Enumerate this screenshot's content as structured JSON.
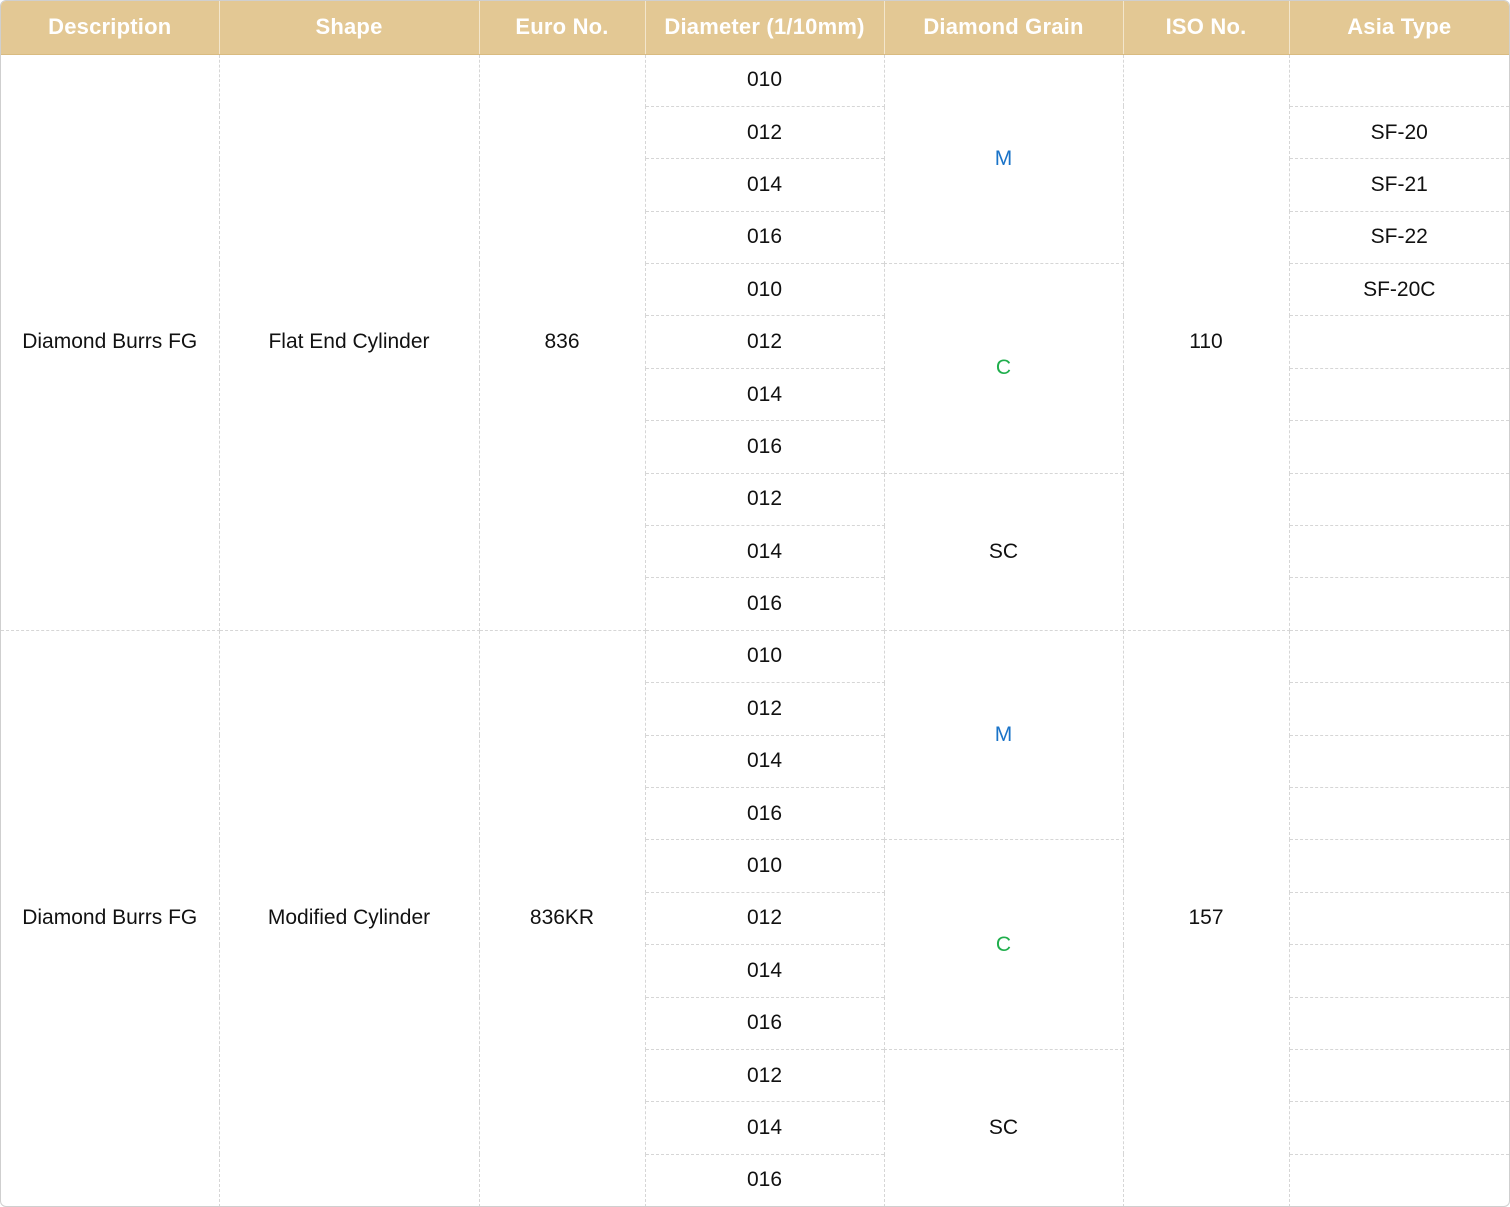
{
  "colors": {
    "header_bg": "#e3c894",
    "header_text": "#ffffff",
    "grain_M": "#1a73c8",
    "grain_C": "#1fae4c",
    "grain_SC": "#111111"
  },
  "columns": [
    "Description",
    "Shape",
    "Euro No.",
    "Diameter (1/10mm)",
    "Diamond Grain",
    "ISO No.",
    "Asia Type"
  ],
  "groups": [
    {
      "description": "Diamond Burrs FG",
      "shape": "Flat End Cylinder",
      "euro_no": "836",
      "iso_no": "110",
      "grains": [
        {
          "grain": "M",
          "diameters": [
            "010",
            "012",
            "014",
            "016"
          ]
        },
        {
          "grain": "C",
          "diameters": [
            "010",
            "012",
            "014",
            "016"
          ]
        },
        {
          "grain": "SC",
          "diameters": [
            "012",
            "014",
            "016"
          ]
        }
      ],
      "asia_types": [
        "",
        "SF-20",
        "SF-21",
        "SF-22",
        "SF-20C",
        "",
        "",
        "",
        "",
        "",
        ""
      ]
    },
    {
      "description": "Diamond Burrs FG",
      "shape": "Modified Cylinder",
      "euro_no": "836KR",
      "iso_no": "157",
      "grains": [
        {
          "grain": "M",
          "diameters": [
            "010",
            "012",
            "014",
            "016"
          ]
        },
        {
          "grain": "C",
          "diameters": [
            "010",
            "012",
            "014",
            "016"
          ]
        },
        {
          "grain": "SC",
          "diameters": [
            "012",
            "014",
            "016"
          ]
        }
      ],
      "asia_types": [
        "",
        "",
        "",
        "",
        "",
        "",
        "",
        "",
        "",
        "",
        ""
      ]
    }
  ]
}
